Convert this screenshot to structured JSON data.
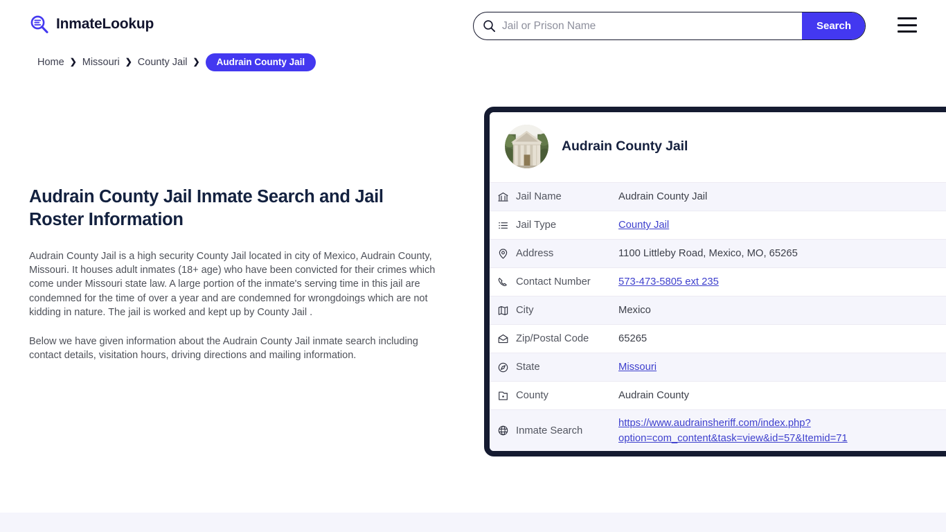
{
  "header": {
    "brand_name": "InmateLookup",
    "brand_icon": "magnifier-list-icon",
    "search": {
      "placeholder": "Jail or Prison Name",
      "value": "",
      "button_label": "Search",
      "icon": "search-icon"
    },
    "menu_icon": "hamburger-menu-icon",
    "accent_color": "#4338f0"
  },
  "breadcrumb": {
    "items": [
      {
        "label": "Home",
        "current": false
      },
      {
        "label": "Missouri",
        "current": false
      },
      {
        "label": "County Jail",
        "current": false
      },
      {
        "label": "Audrain County Jail",
        "current": true
      }
    ],
    "separator": "❯"
  },
  "main": {
    "title": "Audrain County Jail Inmate Search and Jail Roster Information",
    "paragraphs": [
      "Audrain County Jail is a high security County Jail located in city of Mexico, Audrain County, Missouri. It houses adult inmates (18+ age) who have been convicted for their crimes which come under Missouri state law. A large portion of the inmate's serving time in this jail are condemned for the time of over a year and are condemned for wrongdoings which are not kidding in nature. The jail is worked and kept up by County Jail .",
      "Below we have given information about the Audrain County Jail inmate search including contact details, visitation hours, driving directions and mailing information."
    ]
  },
  "card": {
    "title": "Audrain County Jail",
    "photo_alt": "audrain-county-courthouse-photo",
    "border_color": "#151b31",
    "stripe_color": "#f5f5fc",
    "rows": [
      {
        "icon": "bank-icon",
        "label": "Jail Name",
        "value": "Audrain County Jail",
        "link": false
      },
      {
        "icon": "list-icon",
        "label": "Jail Type",
        "value": "County Jail",
        "link": true
      },
      {
        "icon": "map-pin-icon",
        "label": "Address",
        "value": "1100 Littleby Road, Mexico, MO, 65265",
        "link": false
      },
      {
        "icon": "phone-icon",
        "label": "Contact Number",
        "value": "573-473-5805 ext 235",
        "link": true
      },
      {
        "icon": "map-icon",
        "label": "City",
        "value": "Mexico",
        "link": false
      },
      {
        "icon": "envelope-icon",
        "label": "Zip/Postal Code",
        "value": "65265",
        "link": false
      },
      {
        "icon": "compass-icon",
        "label": "State",
        "value": "Missouri",
        "link": true
      },
      {
        "icon": "county-icon",
        "label": "County",
        "value": "Audrain County",
        "link": false
      },
      {
        "icon": "globe-icon",
        "label": "Inmate Search",
        "value": "https://www.audrainsheriff.com/index.php?option=com_content&task=view&id=57&Itemid=71",
        "link": true
      }
    ]
  }
}
